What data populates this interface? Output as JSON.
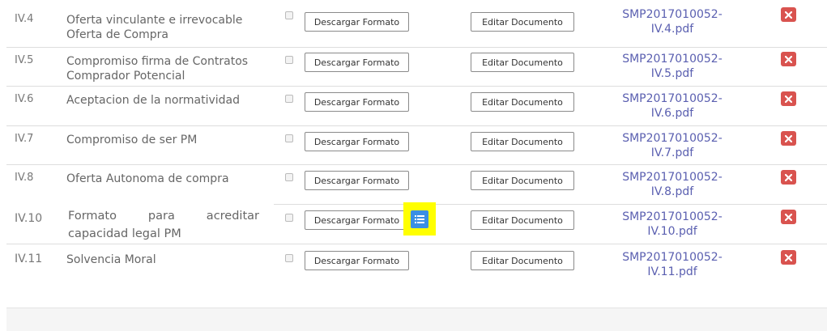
{
  "colors": {
    "link": "#5a5fb0",
    "delete": "#d9534f",
    "list_button": "#3a8fe4",
    "highlight": "#ffff00"
  },
  "icons": {
    "delete": "close-icon",
    "list": "list-icon"
  },
  "rows": [
    {
      "code": "IV.4",
      "description": "Oferta vinculante e irrevocable Oferta de Compra",
      "download_label": "Descargar Formato",
      "edit_label": "Editar Documento",
      "file_line1": "SMP2017010052-",
      "file_line2": "IV.4.pdf"
    },
    {
      "code": "IV.5",
      "description": "Compromiso firma de Contratos Comprador Potencial",
      "download_label": "Descargar Formato",
      "edit_label": "Editar Documento",
      "file_line1": "SMP2017010052-",
      "file_line2": "IV.5.pdf"
    },
    {
      "code": "IV.6",
      "description": "Aceptacion de la normatividad",
      "download_label": "Descargar Formato",
      "edit_label": "Editar Documento",
      "file_line1": "SMP2017010052-",
      "file_line2": "IV.6.pdf"
    },
    {
      "code": "IV.7",
      "description": "Compromiso de ser PM",
      "download_label": "Descargar Formato",
      "edit_label": "Editar Documento",
      "file_line1": "SMP2017010052-",
      "file_line2": "IV.7.pdf"
    },
    {
      "code": "IV.8",
      "description": "Oferta Autonoma de compra",
      "download_label": "Descargar Formato",
      "edit_label": "Editar Documento",
      "file_line1": "SMP2017010052-",
      "file_line2": "IV.8.pdf"
    },
    {
      "code": "IV.10",
      "description": "Formato para acreditar capacidad legal PM",
      "download_label": "Descargar Formato",
      "edit_label": "Editar Documento",
      "file_line1": "SMP2017010052-",
      "file_line2": "IV.10.pdf"
    },
    {
      "code": "IV.11",
      "description": "Solvencia Moral",
      "download_label": "Descargar Formato",
      "edit_label": "Editar Documento",
      "file_line1": "SMP2017010052-",
      "file_line2": "IV.11.pdf"
    }
  ]
}
